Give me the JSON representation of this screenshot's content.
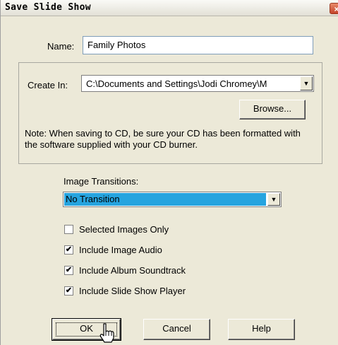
{
  "dialog": {
    "title": "Save Slide Show",
    "close_symbol": "×"
  },
  "name_field": {
    "label": "Name:",
    "value": "Family Photos"
  },
  "create_in": {
    "label": "Create In:",
    "value": "C:\\Documents and Settings\\Jodi Chromey\\M",
    "browse_label": "Browse..."
  },
  "note": "Note: When saving to CD, be sure your CD has been formatted with the software supplied with your CD burner.",
  "transitions": {
    "label": "Image Transitions:",
    "selected": "No Transition",
    "highlight_color": "#26a4df"
  },
  "options": [
    {
      "label": "Selected Images Only",
      "checked": false
    },
    {
      "label": "Include Image Audio",
      "checked": true
    },
    {
      "label": "Include Album Soundtrack",
      "checked": true
    },
    {
      "label": "Include Slide Show Player",
      "checked": true
    }
  ],
  "buttons": {
    "ok": "OK",
    "cancel": "Cancel",
    "help": "Help"
  },
  "icons": {
    "dropdown": "chevron-down-icon",
    "cursor": "hand-pointer-icon",
    "check": "checkmark-icon"
  }
}
